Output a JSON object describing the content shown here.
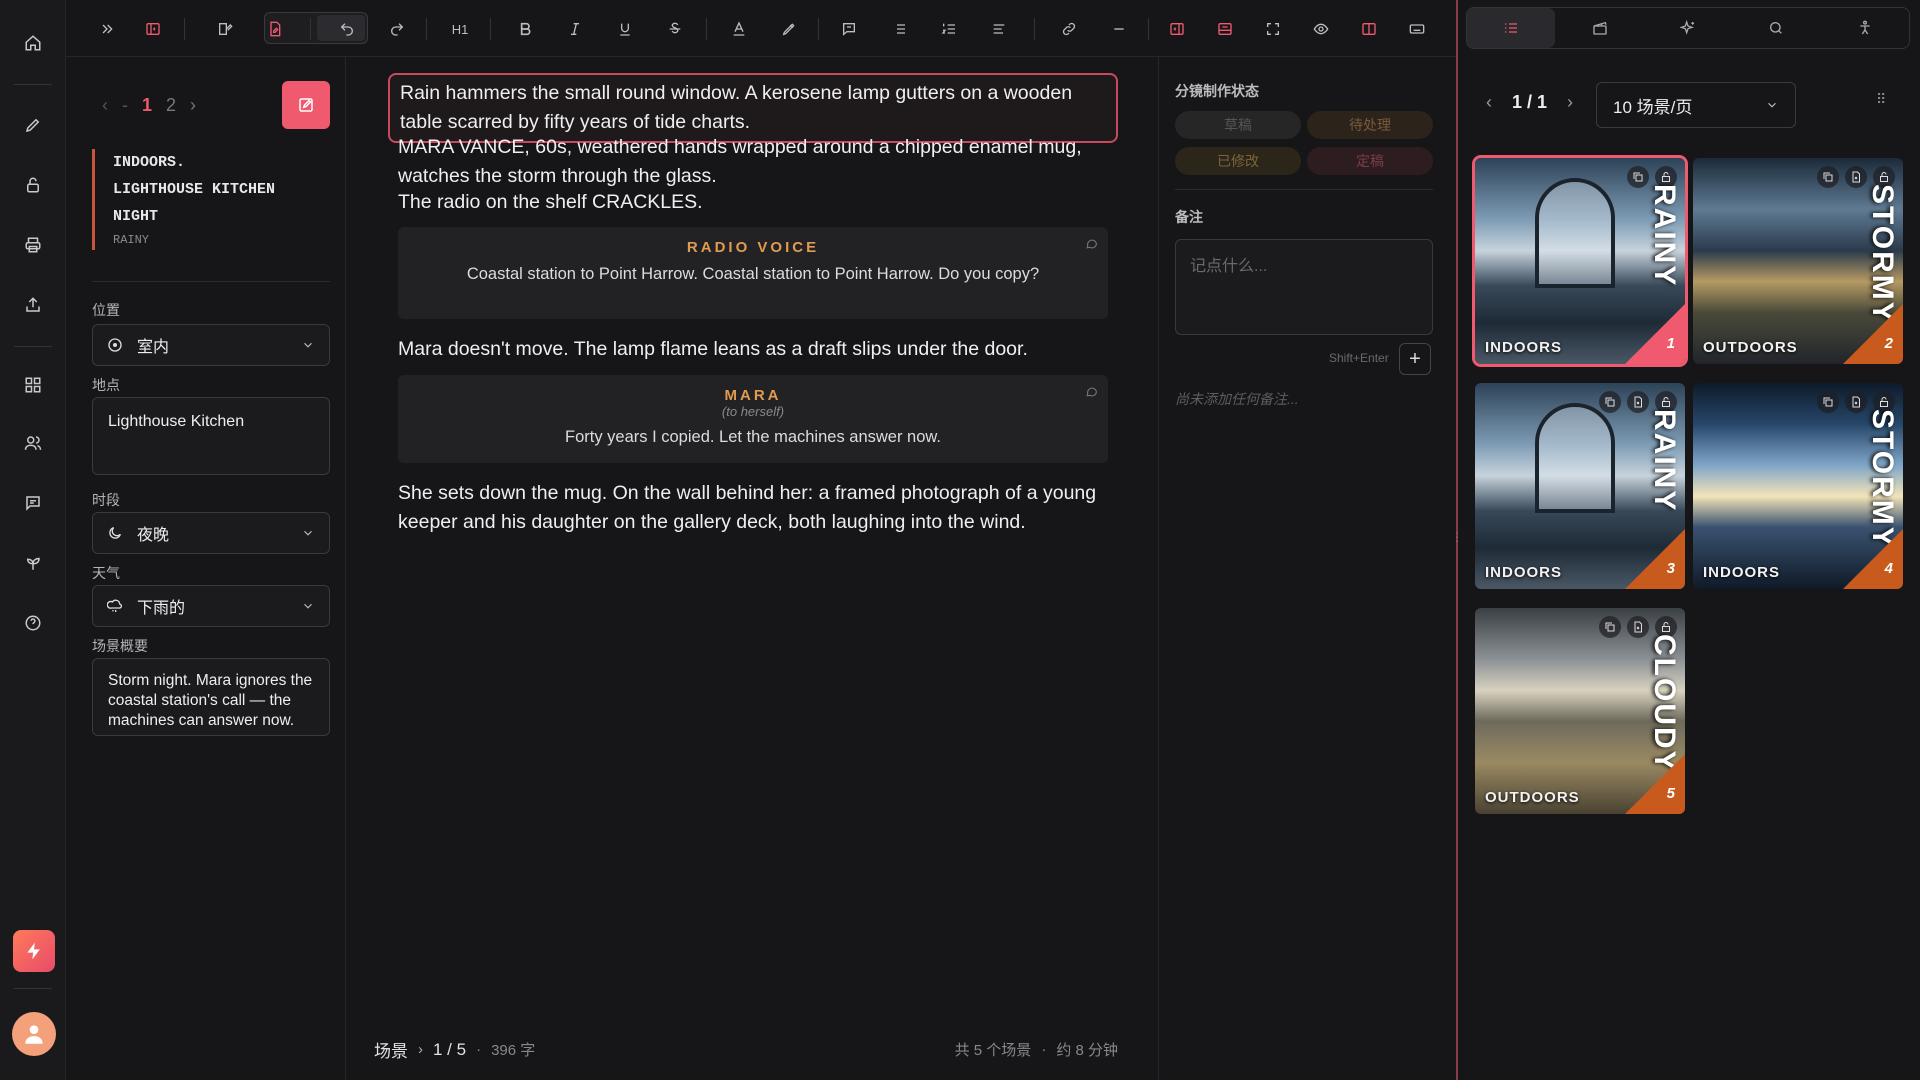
{
  "toolbar": {
    "heading_label": "H1"
  },
  "scene_nav": {
    "pages": [
      "1",
      "2"
    ],
    "current": "1"
  },
  "scene_heading": {
    "line1": "INDOORS.",
    "line2": "LIGHTHOUSE KITCHEN",
    "line3": "NIGHT",
    "weather_tag": "RAINY"
  },
  "fields": {
    "position_label": "位置",
    "position_value": "室内",
    "location_label": "地点",
    "location_value": "Lighthouse Kitchen",
    "time_label": "时段",
    "time_value": "夜晚",
    "weather_label": "天气",
    "weather_value": "下雨的",
    "summary_label": "场景概要",
    "summary_value": "Storm night. Mara ignores the coastal station's call — the machines can answer now."
  },
  "script": {
    "p1": "Rain hammers the small round window. A kerosene lamp gutters on a wooden table scarred by fifty years of tide charts.",
    "p2": "MARA VANCE, 60s, weathered hands wrapped around a chipped enamel mug, watches the storm through the glass.",
    "p3": "The radio on the shelf CRACKLES.",
    "d1_who": "RADIO VOICE",
    "d1_line": "Coastal station to Point Harrow. Coastal station to Point Harrow. Do you copy?",
    "p4": "Mara doesn't move. The lamp flame leans as a draft slips under the door.",
    "d2_who": "MARA",
    "d2_paren": "(to herself)",
    "d2_line": "Forty years I copied. Let the machines answer now.",
    "p5": "She sets down the mug. On the wall behind her: a framed photograph of a young keeper and his daughter on the gallery deck, both laughing into the wind."
  },
  "footer": {
    "scene_label": "场景",
    "scene_pos": "1 / 5",
    "word_count": "396 字",
    "total_scenes": "共 5 个场景",
    "duration": "约 8 分钟"
  },
  "status_panel": {
    "title": "分镜制作状态",
    "chips": [
      "草稿",
      "待处理",
      "已修改",
      "定稿"
    ],
    "notes_title": "备注",
    "notes_placeholder": "记点什么...",
    "hint": "Shift+Enter",
    "empty": "尚未添加任何备注..."
  },
  "storyboard": {
    "page": "1 / 1",
    "per_page": "10 场景/页",
    "items": [
      {
        "tag": "INDOORS",
        "vtext": "RAINY",
        "num": "1"
      },
      {
        "tag": "OUTDOORS",
        "vtext": "STORMY",
        "num": "2"
      },
      {
        "tag": "INDOORS",
        "vtext": "RAINY",
        "num": "3"
      },
      {
        "tag": "INDOORS",
        "vtext": "STORMY",
        "num": "4"
      },
      {
        "tag": "OUTDOORS",
        "vtext": "CLOUDY",
        "num": "5"
      }
    ]
  },
  "colors": {
    "accent": "#ef5a6f",
    "orange": "#c95a1e",
    "heading_bar": "#c6553a"
  }
}
